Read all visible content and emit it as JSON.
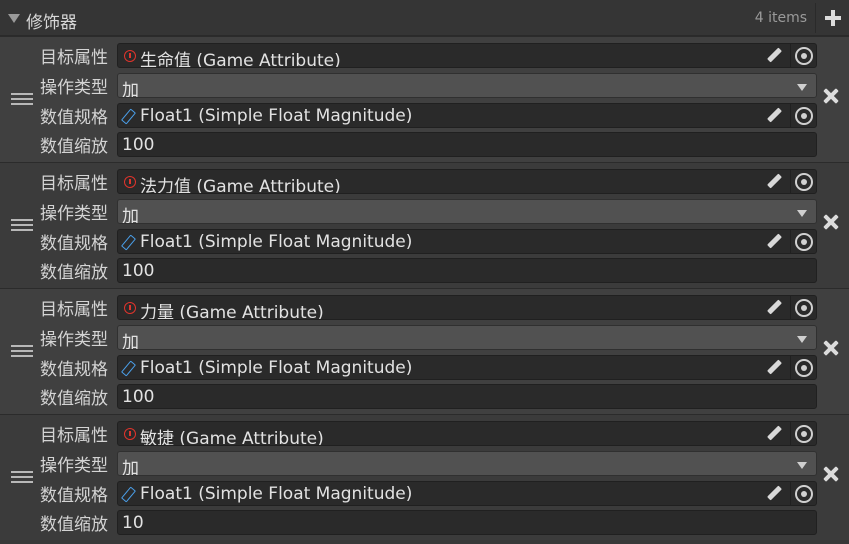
{
  "header": {
    "title": "修饰器",
    "count": "4 items"
  },
  "labels": {
    "attribute": "目标属性",
    "operation": "操作类型",
    "magnitude_spec": "数值规格",
    "scale": "数值缩放"
  },
  "items": [
    {
      "attribute": "生命值 (Game Attribute)",
      "operation": "加",
      "magnitude": "Float1 (Simple Float Magnitude)",
      "scale": "100"
    },
    {
      "attribute": "法力值 (Game Attribute)",
      "operation": "加",
      "magnitude": "Float1 (Simple Float Magnitude)",
      "scale": "100"
    },
    {
      "attribute": "力量 (Game Attribute)",
      "operation": "加",
      "magnitude": "Float1 (Simple Float Magnitude)",
      "scale": "100"
    },
    {
      "attribute": "敏捷 (Game Attribute)",
      "operation": "加",
      "magnitude": "Float1 (Simple Float Magnitude)",
      "scale": "10"
    }
  ],
  "icons": {
    "foldout": "triangle-down-icon",
    "add": "plus-icon",
    "remove": "close-icon",
    "drag": "drag-handle-icon",
    "attribute": "game-attribute-icon",
    "magnitude": "float-magnitude-icon",
    "edit": "pencil-icon",
    "picker": "object-picker-icon"
  },
  "colors": {
    "attribute_icon": "#e0342c",
    "magnitude_icon": "#4a9ee8"
  }
}
